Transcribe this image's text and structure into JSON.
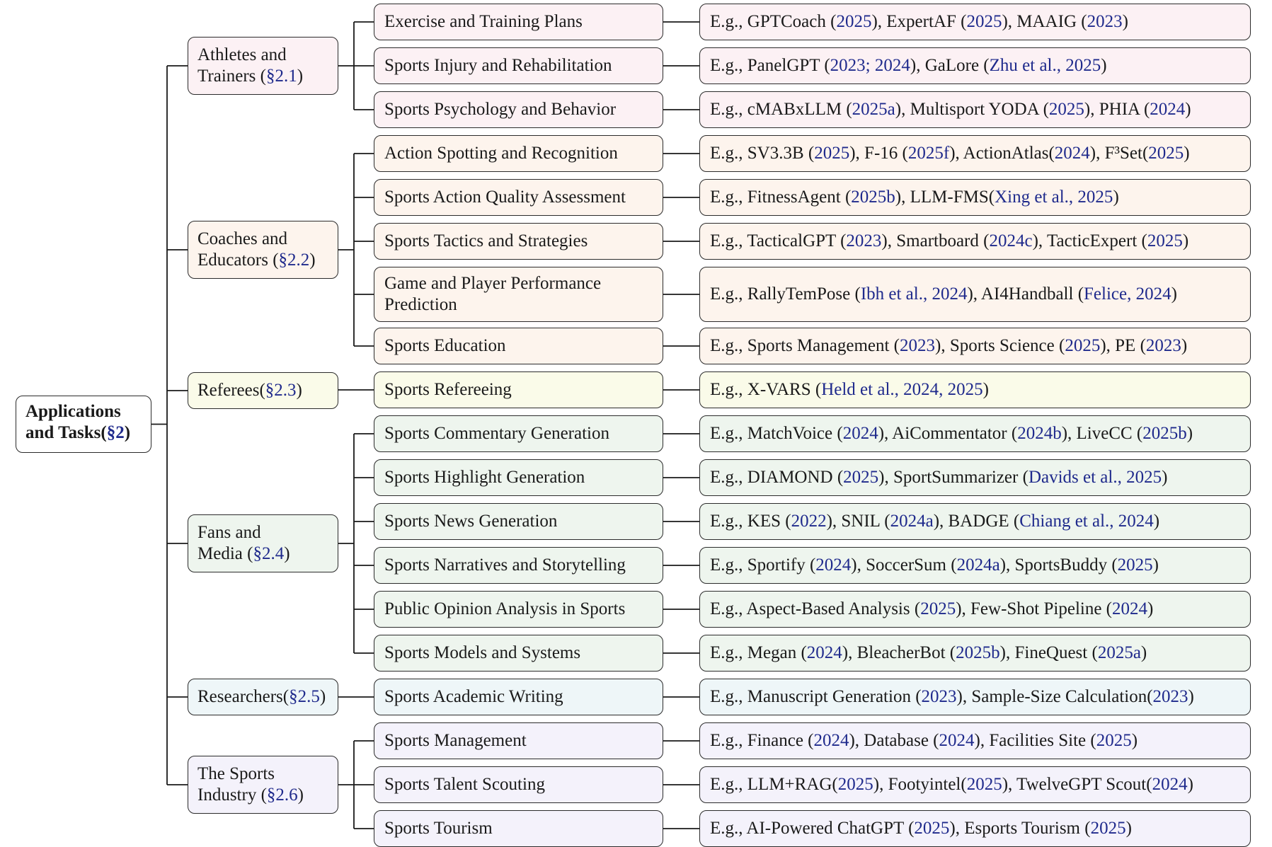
{
  "root": {
    "line1": "Applications",
    "line2_prefix": "and Tasks(",
    "line2_ref": "§2",
    "line2_suffix": ")"
  },
  "categories": [
    {
      "line1": "Athletes and",
      "line2": "Trainers (",
      "ref": "§2.1",
      "suffix": ")",
      "color": "#fcf1f4",
      "tasks": [
        {
          "label": "Exercise and Training Plans",
          "example": [
            [
              "t",
              "E.g., GPTCoach ("
            ],
            [
              "c",
              "2025"
            ],
            [
              "t",
              "), ExpertAF ("
            ],
            [
              "c",
              "2025"
            ],
            [
              "t",
              "), MAAIG ("
            ],
            [
              "c",
              "2023"
            ],
            [
              "t",
              ")"
            ]
          ]
        },
        {
          "label": "Sports Injury and Rehabilitation",
          "example": [
            [
              "t",
              "E.g., PanelGPT ("
            ],
            [
              "c",
              "2023; 2024"
            ],
            [
              "t",
              "), GaLore ("
            ],
            [
              "c",
              "Zhu et al., 2025"
            ],
            [
              "t",
              ")"
            ]
          ]
        },
        {
          "label": "Sports Psychology and Behavior",
          "example": [
            [
              "t",
              "E.g., cMABxLLM ("
            ],
            [
              "c",
              "2025a"
            ],
            [
              "t",
              "), Multisport YODA ("
            ],
            [
              "c",
              "2025"
            ],
            [
              "t",
              "), PHIA ("
            ],
            [
              "c",
              "2024"
            ],
            [
              "t",
              ")"
            ]
          ]
        }
      ]
    },
    {
      "line1": "Coaches and",
      "line2": "Educators (",
      "ref": "§2.2",
      "suffix": ")",
      "color": "#fdf4ed",
      "tasks": [
        {
          "label": "Action Spotting and Recognition",
          "example": [
            [
              "t",
              "E.g., SV3.3B ("
            ],
            [
              "c",
              "2025"
            ],
            [
              "t",
              "), F-16 ("
            ],
            [
              "c",
              "2025f"
            ],
            [
              "t",
              "), ActionAtlas("
            ],
            [
              "c",
              "2024"
            ],
            [
              "t",
              "), F³Set("
            ],
            [
              "c",
              "2025"
            ],
            [
              "t",
              ")"
            ]
          ]
        },
        {
          "label": "Sports Action Quality Assessment",
          "example": [
            [
              "t",
              "E.g., FitnessAgent ("
            ],
            [
              "c",
              "2025b"
            ],
            [
              "t",
              "), LLM-FMS("
            ],
            [
              "c",
              "Xing et al., 2025"
            ],
            [
              "t",
              ")"
            ]
          ]
        },
        {
          "label": "Sports Tactics and Strategies",
          "example": [
            [
              "t",
              "E.g., TacticalGPT ("
            ],
            [
              "c",
              "2023"
            ],
            [
              "t",
              "), Smartboard ("
            ],
            [
              "c",
              "2024c"
            ],
            [
              "t",
              "), TacticExpert ("
            ],
            [
              "c",
              "2025"
            ],
            [
              "t",
              ")"
            ]
          ]
        },
        {
          "label": "Game and Player Performance Prediction",
          "label_line1": "Game and Player Performance",
          "label_line2": "Prediction",
          "example": [
            [
              "t",
              "E.g., RallyTemPose ("
            ],
            [
              "c",
              "Ibh et al., 2024"
            ],
            [
              "t",
              "), AI4Handball ("
            ],
            [
              "c",
              "Felice, 2024"
            ],
            [
              "t",
              ")"
            ]
          ]
        },
        {
          "label": "Sports Education",
          "example": [
            [
              "t",
              "E.g., Sports Management ("
            ],
            [
              "c",
              "2023"
            ],
            [
              "t",
              "), Sports Science ("
            ],
            [
              "c",
              "2025"
            ],
            [
              "t",
              "), PE ("
            ],
            [
              "c",
              "2023"
            ],
            [
              "t",
              ")"
            ]
          ]
        }
      ]
    },
    {
      "line1": "Referees(",
      "line2": "",
      "ref": "§2.3",
      "suffix": ")",
      "single": true,
      "color": "#fafbe9",
      "tasks": [
        {
          "label": "Sports Refereeing",
          "example": [
            [
              "t",
              "E.g., X-VARS ("
            ],
            [
              "c",
              "Held et al., 2024, 2025"
            ],
            [
              "t",
              ")"
            ]
          ]
        }
      ]
    },
    {
      "line1": "Fans and",
      "line2": "Media (",
      "ref": "§2.4",
      "suffix": ")",
      "color": "#eef5ee",
      "tasks": [
        {
          "label": "Sports Commentary Generation",
          "example": [
            [
              "t",
              "E.g., MatchVoice ("
            ],
            [
              "c",
              "2024"
            ],
            [
              "t",
              "), AiCommentator ("
            ],
            [
              "c",
              "2024b"
            ],
            [
              "t",
              "), LiveCC ("
            ],
            [
              "c",
              "2025b"
            ],
            [
              "t",
              ")"
            ]
          ]
        },
        {
          "label": "Sports Highlight Generation",
          "example": [
            [
              "t",
              "E.g., DIAMOND ("
            ],
            [
              "c",
              "2025"
            ],
            [
              "t",
              "), SportSummarizer ("
            ],
            [
              "c",
              "Davids et al., 2025"
            ],
            [
              "t",
              ")"
            ]
          ]
        },
        {
          "label": "Sports News Generation",
          "example": [
            [
              "t",
              "E.g., KES ("
            ],
            [
              "c",
              "2022"
            ],
            [
              "t",
              "), SNIL ("
            ],
            [
              "c",
              "2024a"
            ],
            [
              "t",
              "), BADGE ("
            ],
            [
              "c",
              "Chiang et al., 2024"
            ],
            [
              "t",
              ")"
            ]
          ]
        },
        {
          "label": "Sports Narratives and Storytelling",
          "example": [
            [
              "t",
              "E.g., Sportify ("
            ],
            [
              "c",
              "2024"
            ],
            [
              "t",
              "), SoccerSum ("
            ],
            [
              "c",
              "2024a"
            ],
            [
              "t",
              "), SportsBuddy ("
            ],
            [
              "c",
              "2025"
            ],
            [
              "t",
              ")"
            ]
          ]
        },
        {
          "label": "Public Opinion Analysis in Sports",
          "example": [
            [
              "t",
              "E.g., Aspect-Based Analysis ("
            ],
            [
              "c",
              "2025"
            ],
            [
              "t",
              "), Few-Shot Pipeline ("
            ],
            [
              "c",
              "2024"
            ],
            [
              "t",
              ")"
            ]
          ]
        },
        {
          "label": "Sports Models and Systems",
          "example": [
            [
              "t",
              "E.g., Megan ("
            ],
            [
              "c",
              "2024"
            ],
            [
              "t",
              "), BleacherBot ("
            ],
            [
              "c",
              "2025b"
            ],
            [
              "t",
              "), FineQuest ("
            ],
            [
              "c",
              "2025a"
            ],
            [
              "t",
              ")"
            ]
          ]
        }
      ]
    },
    {
      "line1": "Researchers(",
      "line2": "",
      "ref": "§2.5",
      "suffix": ")",
      "single": true,
      "color": "#eef6f8",
      "tasks": [
        {
          "label": "Sports Academic Writing",
          "example": [
            [
              "t",
              "E.g., Manuscript Generation ("
            ],
            [
              "c",
              "2023"
            ],
            [
              "t",
              "), Sample-Size Calculation("
            ],
            [
              "c",
              "2023"
            ],
            [
              "t",
              ")"
            ]
          ]
        }
      ]
    },
    {
      "line1": "The Sports",
      "line2": "Industry (",
      "ref": "§2.6",
      "suffix": ")",
      "color": "#f4f2fb",
      "tasks": [
        {
          "label": "Sports Management",
          "example": [
            [
              "t",
              "E.g., Finance ("
            ],
            [
              "c",
              "2024"
            ],
            [
              "t",
              "), Database ("
            ],
            [
              "c",
              "2024"
            ],
            [
              "t",
              "), Facilities Site ("
            ],
            [
              "c",
              "2025"
            ],
            [
              "t",
              ")"
            ]
          ]
        },
        {
          "label": "Sports Talent Scouting",
          "example": [
            [
              "t",
              "E.g., LLM+RAG("
            ],
            [
              "c",
              "2025"
            ],
            [
              "t",
              "), Footyintel("
            ],
            [
              "c",
              "2025"
            ],
            [
              "t",
              "), TwelveGPT Scout("
            ],
            [
              "c",
              "2024"
            ],
            [
              "t",
              ")"
            ]
          ]
        },
        {
          "label": "Sports Tourism",
          "example": [
            [
              "t",
              "E.g., AI-Powered ChatGPT ("
            ],
            [
              "c",
              "2025"
            ],
            [
              "t",
              "), Esports Tourism ("
            ],
            [
              "c",
              "2025"
            ],
            [
              "t",
              ")"
            ]
          ]
        }
      ]
    }
  ]
}
